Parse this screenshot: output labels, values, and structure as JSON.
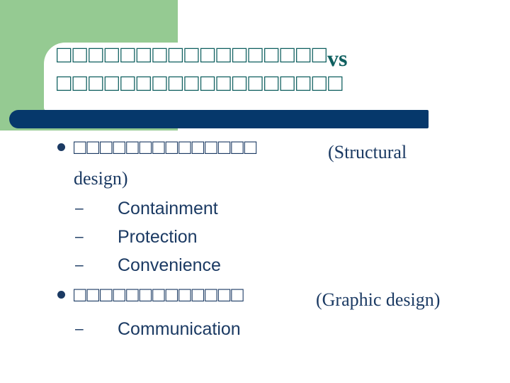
{
  "slide": {
    "background_color": "#FFFFFF",
    "decor": {
      "green_block_color": "#95CA92",
      "white_panel_color": "#FFFFFF",
      "navy_bar_color": "#06386B"
    },
    "title": {
      "color": "#0E5F5F",
      "line1_tofu": "□□□□□□□□□□□□□□□□□",
      "line1_overlay": "vs",
      "line2_tofu": "□□□□□□□□□□□□□□□□□□"
    },
    "body": {
      "color": "#1B3A63",
      "bullets": [
        {
          "level": 1,
          "bullet_glyph": "•",
          "tofu_before": "□□□□□□□□□",
          "overlay": "(Structural",
          "tofu_after": "□□□□□",
          "wrap_text": "design)",
          "children": [
            {
              "level": 2,
              "dash": "–",
              "label": "Containment"
            },
            {
              "level": 2,
              "dash": "–",
              "label": "Protection"
            },
            {
              "level": 2,
              "dash": "–",
              "label": "Convenience"
            }
          ]
        },
        {
          "level": 1,
          "bullet_glyph": "•",
          "tofu_before": "□□□□□□□□□",
          "overlay": "(Graphic design)",
          "tofu_after": "□□□□",
          "wrap_text": "",
          "children": [
            {
              "level": 2,
              "dash": "–",
              "label": "Communication"
            }
          ]
        }
      ]
    }
  }
}
